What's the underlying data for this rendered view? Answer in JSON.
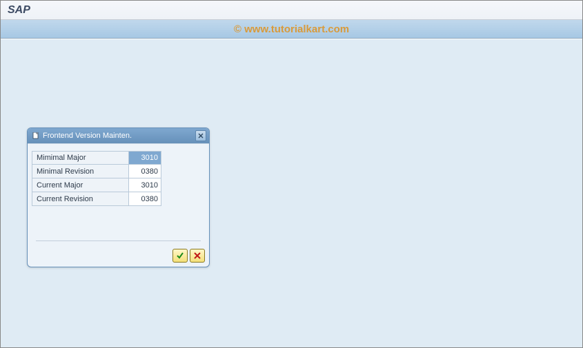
{
  "header": {
    "title": "SAP"
  },
  "watermark": "© www.tutorialkart.com",
  "dialog": {
    "title": "Frontend Version Mainten.",
    "fields": [
      {
        "label": "Mimimal Major",
        "value": "3010",
        "selected": true
      },
      {
        "label": "Minimal Revision",
        "value": "0380",
        "selected": false
      },
      {
        "label": "Current Major",
        "value": "3010",
        "selected": false
      },
      {
        "label": "Current Revision",
        "value": "0380",
        "selected": false
      }
    ]
  }
}
